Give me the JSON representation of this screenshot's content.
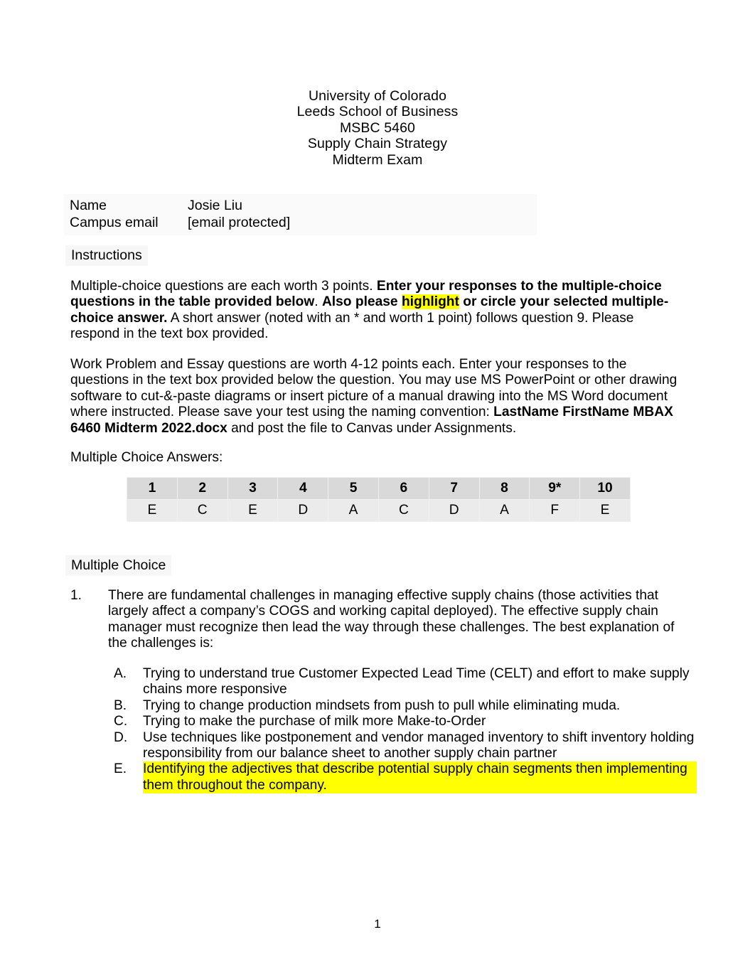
{
  "document": {
    "header_lines": [
      "University of Colorado",
      "Leeds School of Business",
      "MSBC 5460",
      "Supply Chain Strategy",
      "Midterm Exam"
    ],
    "page_number": "1"
  },
  "identity": {
    "name_label": "Name",
    "name_value": "Josie Liu",
    "email_label": "Campus email",
    "email_value": "[email protected]"
  },
  "sections": {
    "instructions_label": "Instructions",
    "multiple_choice_answers_label": "Multiple Choice Answers:",
    "multiple_choice_label": "Multiple Choice"
  },
  "instructions": {
    "paragraph_1": {
      "t1": "Multiple-choice questions are each worth 3 points.  ",
      "t2_bold": "Enter your responses to the multiple-choice questions in the table provided below",
      "t3": ".  ",
      "t4_bold": "Also please ",
      "t5_bold_highlight": "highlight",
      "t6_bold": " or circle your selected multiple-choice answer.",
      "t7": "  A short answer (noted with an * and worth 1 point) follows question 9.  Please respond in the text box provided."
    },
    "paragraph_2": {
      "t1": "Work Problem and Essay questions are worth 4-12 points each.  Enter your responses to the questions in the text box provided below the question.  You may use MS PowerPoint or other drawing software to cut-&-paste diagrams or insert picture of a manual drawing into the MS Word document where instructed.  Please save your test using the naming convention:  ",
      "t2_bold": "LastName FirstName MBAX 6460 Midterm 2022.docx",
      "t3": " and post the file to Canvas under Assignments."
    }
  },
  "answer_table": {
    "headers": [
      "1",
      "2",
      "3",
      "4",
      "5",
      "6",
      "7",
      "8",
      "9*",
      "10"
    ],
    "answers": [
      "E",
      "C",
      "E",
      "D",
      "A",
      "C",
      "D",
      "A",
      "F",
      "E"
    ],
    "header_bg": "#d9d9d9",
    "answer_bg": "#ebebeb"
  },
  "questions": [
    {
      "number": "1.",
      "text": "There are fundamental challenges in managing effective supply chains (those activities that largely affect a company’s COGS and working capital deployed).  The effective supply chain manager must recognize then lead the way through these challenges.  The best explanation of the challenges is:",
      "options": [
        {
          "letter": "A.",
          "text": "Trying to understand true Customer Expected Lead Time (CELT) and effort to make supply chains more responsive",
          "highlighted": false
        },
        {
          "letter": "B.",
          "text": "Trying to change production mindsets from push to pull while eliminating muda.",
          "highlighted": false
        },
        {
          "letter": "C.",
          "text": "Trying to make the purchase of milk more Make-to-Order",
          "highlighted": false
        },
        {
          "letter": "D.",
          "text": "Use techniques like postponement and vendor managed inventory to shift inventory holding responsibility from our balance sheet to another supply chain partner",
          "highlighted": false
        },
        {
          "letter": "E.",
          "text": "Identifying the adjectives that describe potential supply chain segments then implementing them throughout the company.",
          "highlighted": true
        }
      ]
    }
  ],
  "colors": {
    "highlight": "#ffff00",
    "shaded_block": "#fafafa",
    "section_label_bg": "#f7f7f8"
  }
}
